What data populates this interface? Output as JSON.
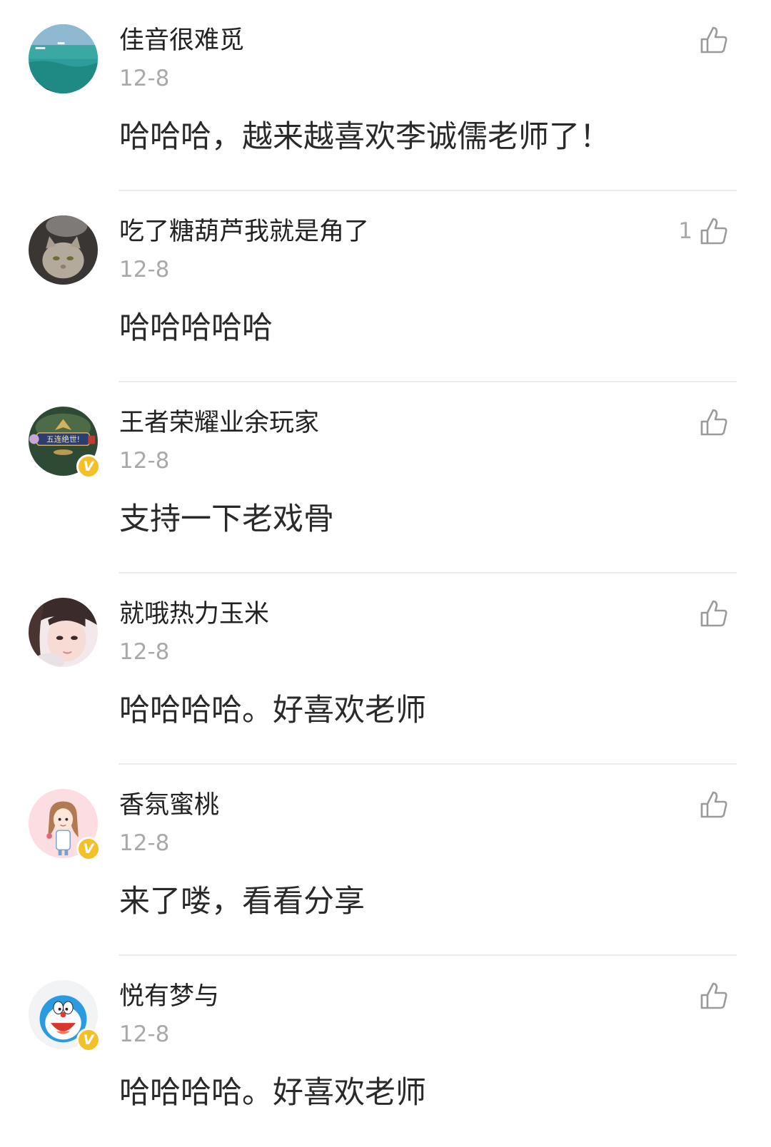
{
  "comments": [
    {
      "username": "佳音很难觅",
      "date": "12-8",
      "text": "哈哈哈，越来越喜欢李诚儒老师了！",
      "likes": "",
      "verified": false,
      "avatar": "ocean-photo"
    },
    {
      "username": "吃了糖葫芦我就是角了",
      "date": "12-8",
      "text": "哈哈哈哈哈",
      "likes": "1",
      "verified": false,
      "avatar": "cat-photo"
    },
    {
      "username": "王者荣耀业余玩家",
      "date": "12-8",
      "text": "支持一下老戏骨",
      "likes": "",
      "verified": true,
      "avatar": "game-banner",
      "avatar_banner_text": "五连绝世!"
    },
    {
      "username": "就哦热力玉米",
      "date": "12-8",
      "text": "哈哈哈哈。好喜欢老师",
      "likes": "",
      "verified": false,
      "avatar": "girl-portrait"
    },
    {
      "username": "香氛蜜桃",
      "date": "12-8",
      "text": "来了喽，看看分享",
      "likes": "",
      "verified": true,
      "avatar": "cartoon-girl"
    },
    {
      "username": "悦有梦与",
      "date": "12-8",
      "text": "哈哈哈哈。好喜欢老师",
      "likes": "",
      "verified": true,
      "avatar": "doraemon"
    }
  ],
  "colors": {
    "username": "#222222",
    "meta": "#a9a9a9",
    "badge": "#f4c02a",
    "divider": "#ececec"
  },
  "icons": {
    "like": "thumbs-up-outline-icon",
    "verified": "verified-v-badge-icon"
  }
}
